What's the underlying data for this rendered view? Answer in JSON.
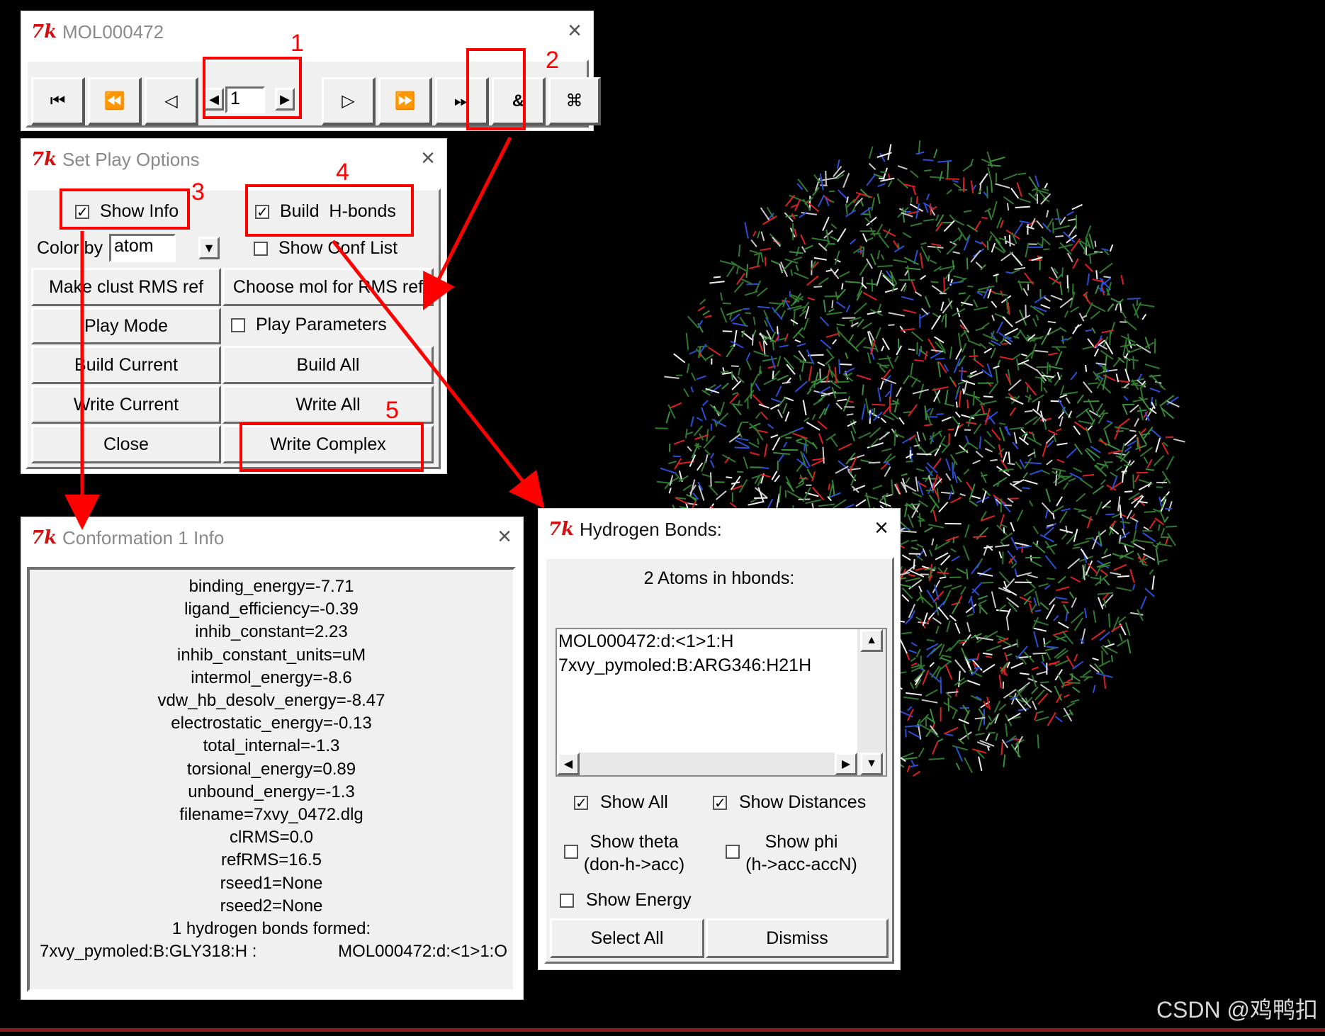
{
  "player": {
    "title": "MOL000472",
    "buttons": [
      "⏮",
      "⏪",
      "◁",
      "▷",
      "⏩",
      "⏭",
      "&",
      "⌘"
    ],
    "frame_value": "1"
  },
  "play_options": {
    "title": "Set Play Options",
    "show_info": "Show Info",
    "build_hbonds": "Build  H-bonds",
    "color_by": "Color by",
    "color_value": "atom",
    "show_conf_list": "Show Conf List",
    "make_clust": "Make clust RMS ref",
    "choose_mol": "Choose mol for RMS ref",
    "play_mode": "Play Mode",
    "play_params": "Play Parameters",
    "build_current": "Build Current",
    "build_all": "Build All",
    "write_current": "Write Current",
    "write_all": "Write All",
    "close": "Close",
    "write_complex": "Write Complex"
  },
  "conf_info": {
    "title": "Conformation 1 Info",
    "lines": [
      "binding_energy=-7.71",
      "ligand_efficiency=-0.39",
      "inhib_constant=2.23",
      "inhib_constant_units=uM",
      "intermol_energy=-8.6",
      "vdw_hb_desolv_energy=-8.47",
      "electrostatic_energy=-0.13",
      "total_internal=-1.3",
      "torsional_energy=0.89",
      "unbound_energy=-1.3",
      "filename=7xvy_0472.dlg",
      "clRMS=0.0",
      "refRMS=16.5",
      "rseed1=None",
      "rseed2=None",
      "1 hydrogen bonds formed:"
    ],
    "hbond_left": "7xvy_pymoled:B:GLY318:H :",
    "hbond_right": "MOL000472:d:<1>1:O"
  },
  "hbonds": {
    "title": "Hydrogen Bonds:",
    "heading": "2 Atoms in hbonds:",
    "items": [
      "MOL000472:d:<1>1:H",
      "7xvy_pymoled:B:ARG346:H21H"
    ],
    "show_all": "Show All",
    "show_distances": "Show Distances",
    "show_theta_1": "Show theta",
    "show_theta_2": "(don-h->acc)",
    "show_phi_1": "Show phi",
    "show_phi_2": "(h->acc-accN)",
    "show_energy": "Show Energy",
    "select_all": "Select All",
    "dismiss": "Dismiss"
  },
  "annotations": [
    "1",
    "2",
    "3",
    "4",
    "5"
  ],
  "watermark": "CSDN @鸡鸭扣",
  "colors": {
    "annotation": "#ff0000",
    "background": "#000000",
    "tk_logo": "#d01010"
  }
}
